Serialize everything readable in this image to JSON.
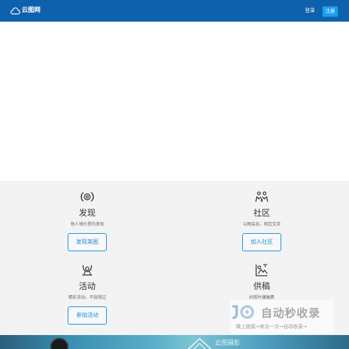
{
  "header": {
    "logo_text": "云图网",
    "login_label": "登录",
    "register_label": "注册"
  },
  "features": [
    {
      "icon": "camera-lens-icon",
      "title": "发现",
      "desc": "他人镜头里的发现",
      "button": "发现美图"
    },
    {
      "icon": "community-icon",
      "title": "社区",
      "desc": "以图会友，相互交流",
      "button": "加入社区"
    },
    {
      "icon": "activity-icon",
      "title": "活动",
      "desc": "精彩活动，不容错过",
      "button": "参加活动"
    },
    {
      "icon": "image-supply-icon",
      "title": "供稿",
      "desc": "好照片赚稿费",
      "button": ""
    }
  ],
  "watermark": {
    "title": "自动秒收录",
    "subtitle": "做上链接→来访一次→自动收录→"
  },
  "banner": {
    "text": "云图摄影"
  },
  "colors": {
    "header_bg": "#0e62ad",
    "register_bg": "#1a9ef0",
    "accent": "#1a8fdb",
    "features_bg": "#f3f3f3"
  }
}
